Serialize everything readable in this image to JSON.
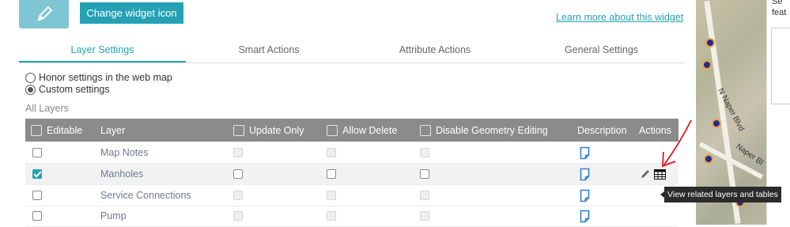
{
  "header": {
    "change_icon_label": "Change widget icon",
    "learn_more_label": "Learn more about this widget",
    "widget_icon": "edit-pencil-icon"
  },
  "tabs": [
    {
      "label": "Layer Settings",
      "active": true
    },
    {
      "label": "Smart Actions",
      "active": false
    },
    {
      "label": "Attribute Actions",
      "active": false
    },
    {
      "label": "General Settings",
      "active": false
    }
  ],
  "settings_mode": {
    "options": [
      {
        "label": "Honor settings in the web map",
        "checked": false
      },
      {
        "label": "Custom settings",
        "checked": true
      }
    ]
  },
  "layers_section": {
    "title": "All Layers"
  },
  "table": {
    "columns": {
      "editable": "Editable",
      "layer": "Layer",
      "update_only": "Update Only",
      "allow_delete": "Allow Delete",
      "disable_geometry": "Disable Geometry Editing",
      "description": "Description",
      "actions": "Actions"
    },
    "rows": [
      {
        "layer": "Map Notes",
        "editable": false,
        "update_only": false,
        "allow_delete": false,
        "disable_geometry": false,
        "actions": []
      },
      {
        "layer": "Manholes",
        "editable": true,
        "update_only": false,
        "allow_delete": false,
        "disable_geometry": false,
        "actions": [
          "pencil-icon",
          "table-icon"
        ]
      },
      {
        "layer": "Service Connections",
        "editable": false,
        "update_only": false,
        "allow_delete": false,
        "disable_geometry": false,
        "actions": []
      },
      {
        "layer": "Pump",
        "editable": false,
        "update_only": false,
        "allow_delete": false,
        "disable_geometry": false,
        "actions": []
      }
    ]
  },
  "tooltip": {
    "text": "View related layers and tables"
  },
  "map": {
    "street_1": "N Naper Blvd",
    "street_2": "Naper Bl"
  },
  "right_panel": {
    "line_1": "Se",
    "line_2": "feat"
  },
  "colors": {
    "accent": "#24a1b5",
    "header_bg": "#8b8b8b",
    "annotation": "#e0141e",
    "tooltip_bg": "#2b2b2b"
  }
}
